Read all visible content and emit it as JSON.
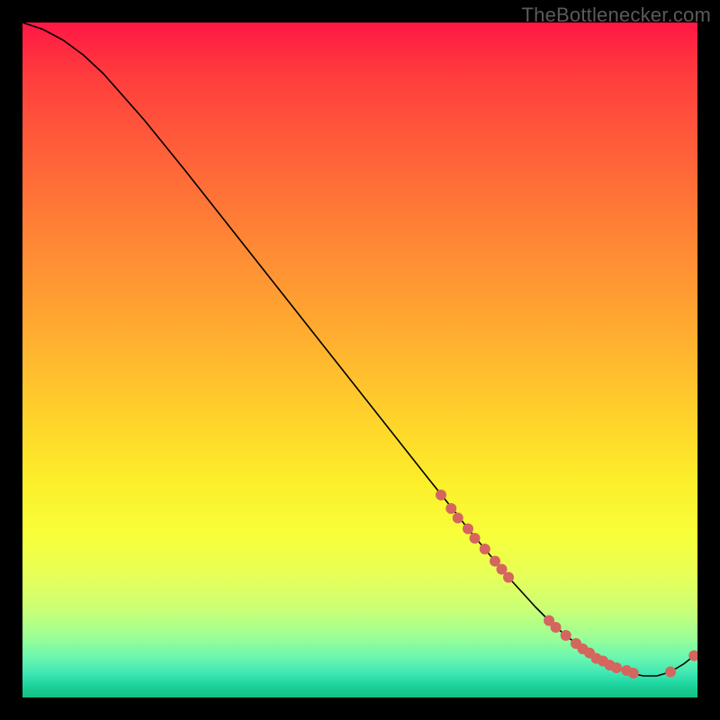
{
  "watermark": "TheBottlenecker.com",
  "chart_data": {
    "type": "line",
    "title": "",
    "xlabel": "",
    "ylabel": "",
    "xlim": [
      0,
      100
    ],
    "ylim": [
      0,
      100
    ],
    "grid": false,
    "legend": false,
    "series": [
      {
        "name": "curve",
        "color": "#000000",
        "x": [
          0,
          3,
          6,
          9,
          12,
          18,
          24,
          30,
          36,
          42,
          48,
          54,
          60,
          64,
          66,
          68,
          70,
          72,
          74,
          76,
          78,
          80,
          82,
          84,
          86,
          88,
          90,
          92,
          94,
          96,
          98,
          100
        ],
        "y": [
          100,
          99.0,
          97.4,
          95.2,
          92.4,
          85.6,
          78.2,
          70.6,
          63.0,
          55.4,
          47.8,
          40.2,
          32.6,
          27.6,
          25.0,
          22.6,
          20.2,
          17.8,
          15.6,
          13.4,
          11.4,
          9.6,
          8.0,
          6.6,
          5.4,
          4.4,
          3.6,
          3.2,
          3.2,
          3.8,
          5.0,
          6.6
        ]
      }
    ],
    "markers": [
      {
        "name": "dots",
        "color": "#d4665f",
        "radius_px": 6,
        "x": [
          62,
          63.5,
          64.5,
          66,
          67,
          68.5,
          70,
          71,
          72,
          78,
          79,
          80.5,
          82,
          83,
          84,
          85,
          86,
          87,
          88,
          89.5,
          90.5,
          96,
          99.5
        ],
        "y": [
          30.0,
          28.0,
          26.6,
          25.0,
          23.6,
          22.0,
          20.2,
          19.0,
          17.8,
          11.4,
          10.4,
          9.2,
          8.0,
          7.2,
          6.6,
          5.8,
          5.4,
          4.8,
          4.4,
          4.0,
          3.6,
          3.8,
          6.2
        ]
      }
    ]
  }
}
